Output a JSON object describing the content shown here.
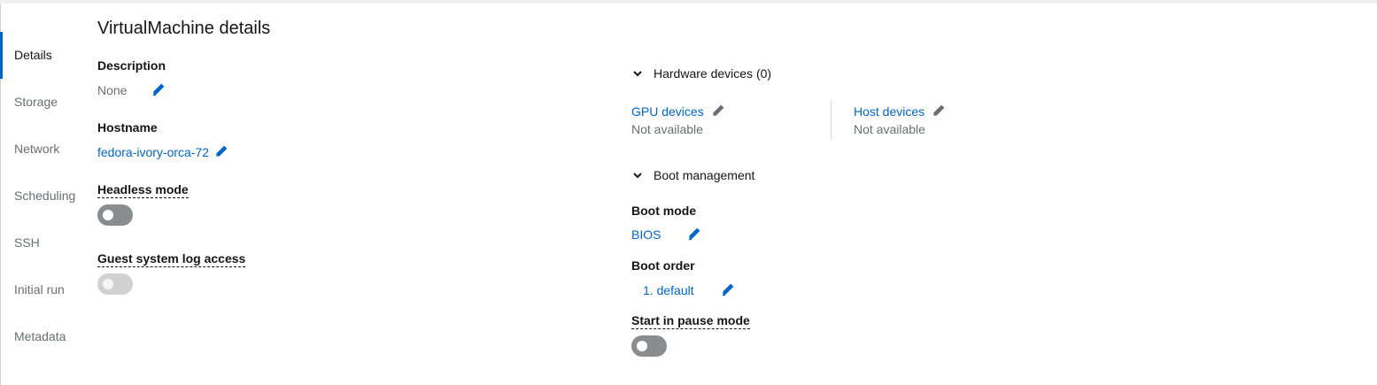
{
  "nav": {
    "items": [
      {
        "label": "Details",
        "active": true
      },
      {
        "label": "Storage"
      },
      {
        "label": "Network"
      },
      {
        "label": "Scheduling"
      },
      {
        "label": "SSH"
      },
      {
        "label": "Initial run"
      },
      {
        "label": "Metadata"
      }
    ]
  },
  "page": {
    "title": "VirtualMachine details"
  },
  "details": {
    "description_label": "Description",
    "description_value": "None",
    "hostname_label": "Hostname",
    "hostname_value": "fedora-ivory-orca-72",
    "headless_label": "Headless mode",
    "headless_on": false,
    "guest_log_label": "Guest system log access",
    "guest_log_on": false
  },
  "hardware": {
    "section_label": "Hardware devices (0)",
    "gpu_label": "GPU devices",
    "gpu_value": "Not available",
    "host_label": "Host devices",
    "host_value": "Not available"
  },
  "boot": {
    "section_label": "Boot management",
    "mode_label": "Boot mode",
    "mode_value": "BIOS",
    "order_label": "Boot order",
    "order_value": "1. default",
    "pause_label": "Start in pause mode",
    "pause_on": false
  },
  "colors": {
    "accent": "#0066cc",
    "toggle_off": "#8a8d90",
    "muted": "#6a6e73"
  }
}
